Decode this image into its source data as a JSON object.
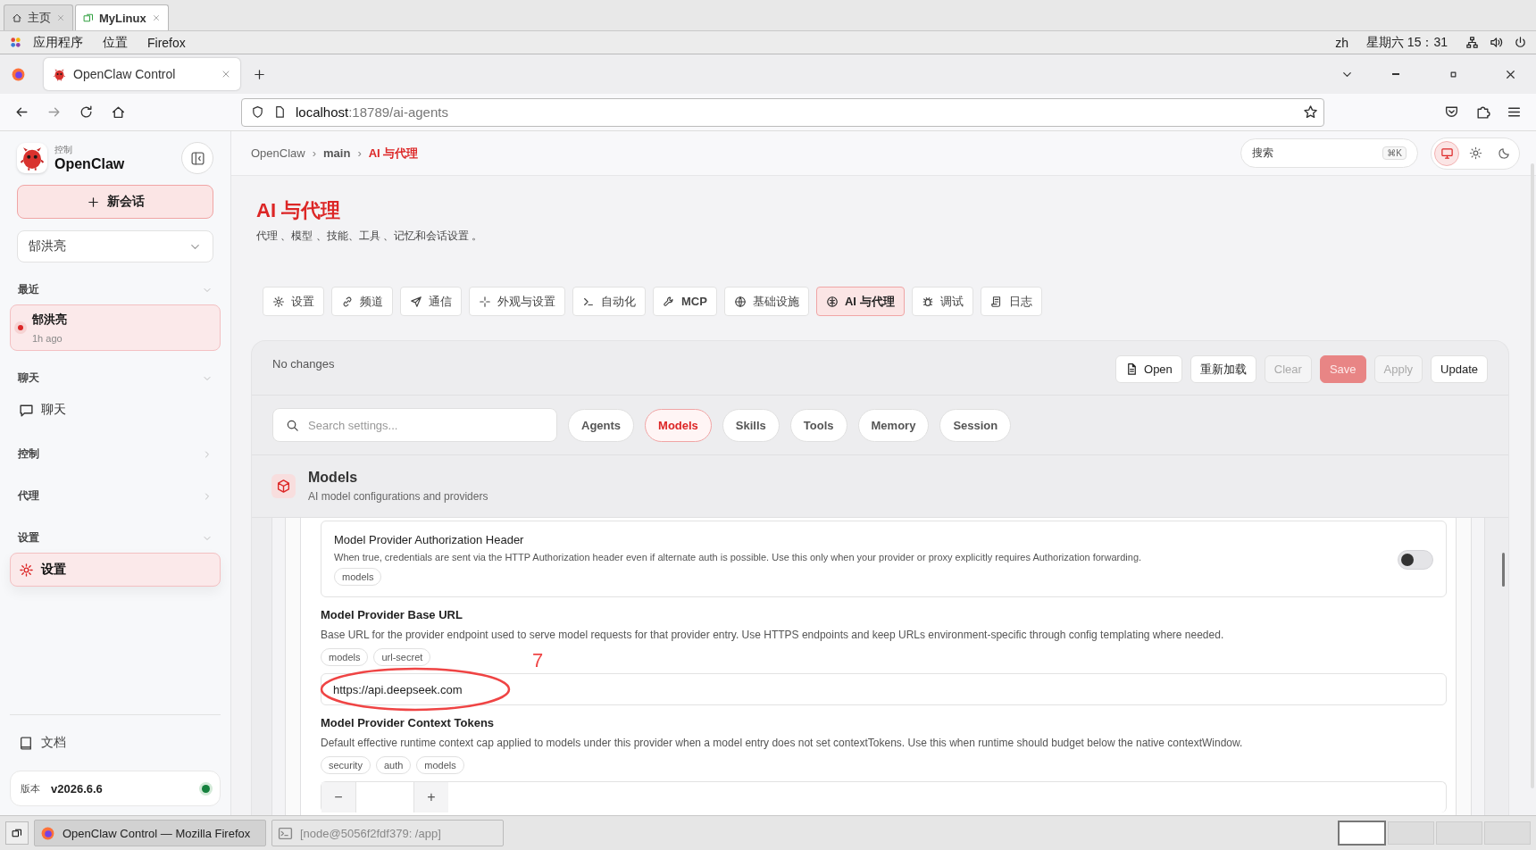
{
  "desktop_tabs": [
    {
      "label": "主页",
      "selected": false
    },
    {
      "label": "MyLinux",
      "selected": true
    }
  ],
  "desktop_menu": [
    "应用程序",
    "位置",
    "Firefox"
  ],
  "desktop_status": {
    "language": "zh",
    "clock": "星期六 15：31"
  },
  "browser_tab": {
    "title": "OpenClaw Control"
  },
  "url": {
    "host": "localhost",
    "rest": ":18789/ai-agents"
  },
  "brand": {
    "caption": "控制",
    "name": "OpenClaw"
  },
  "new_session": {
    "label": "新会话"
  },
  "agent_select": {
    "value": "郜洪亮"
  },
  "sidebar_sections": [
    {
      "title": "最近",
      "expanded": true,
      "items": [
        {
          "kind": "session",
          "label": "郜洪亮",
          "meta": "1h ago",
          "selected": true
        }
      ]
    },
    {
      "title": "聊天",
      "expanded": true,
      "items": [
        {
          "kind": "chat",
          "label": "聊天",
          "selected": false
        }
      ]
    },
    {
      "title": "控制",
      "expanded": false
    },
    {
      "title": "代理",
      "expanded": false
    },
    {
      "title": "设置",
      "expanded": true,
      "items": [
        {
          "kind": "settings",
          "label": "设置",
          "selected": true
        }
      ]
    }
  ],
  "docs_link": {
    "label": "文档"
  },
  "version": {
    "label": "版本",
    "value": "v2026.6.6",
    "online": true
  },
  "breadcrumb": [
    {
      "label": "OpenClaw",
      "kind": "root"
    },
    {
      "label": "main",
      "kind": "agent",
      "separator": "›"
    },
    {
      "label": "AI 与代理",
      "kind": "current",
      "separator": "›"
    }
  ],
  "search": {
    "placeholder": "搜索",
    "shortcut": "⌘K"
  },
  "theme_modes": [
    {
      "kind": "system",
      "selected": true
    },
    {
      "kind": "light",
      "selected": false
    },
    {
      "kind": "dark",
      "selected": false
    }
  ],
  "page": {
    "title": "AI 与代理",
    "subtitle": "代理 、模型 、技能、工具 、记忆和会话设置 。"
  },
  "nav_tabs": [
    {
      "label": "设置",
      "selected": false
    },
    {
      "label": "频道",
      "selected": false
    },
    {
      "label": "通信",
      "selected": false
    },
    {
      "label": "外观与设置",
      "selected": false
    },
    {
      "label": "自动化",
      "selected": false
    },
    {
      "label": "MCP",
      "selected": false
    },
    {
      "label": "基础设施",
      "selected": false
    },
    {
      "label": "AI 与代理",
      "selected": true
    },
    {
      "label": "调试",
      "selected": false
    },
    {
      "label": "日志",
      "selected": false
    }
  ],
  "status": "No changes",
  "actions": [
    {
      "label": "Open",
      "kind": "open",
      "disabled": false
    },
    {
      "label": "重新加载",
      "kind": "plain",
      "disabled": false
    },
    {
      "label": "Clear",
      "kind": "plain",
      "disabled": true
    },
    {
      "label": "Save",
      "kind": "primary",
      "disabled": true
    },
    {
      "label": "Apply",
      "kind": "plain",
      "disabled": true
    },
    {
      "label": "Update",
      "kind": "plain",
      "disabled": false
    }
  ],
  "settings_search": {
    "placeholder": "Search settings..."
  },
  "filters": [
    {
      "label": "Agents",
      "selected": false
    },
    {
      "label": "Models",
      "selected": true
    },
    {
      "label": "Skills",
      "selected": false
    },
    {
      "label": "Tools",
      "selected": false
    },
    {
      "label": "Memory",
      "selected": false
    },
    {
      "label": "Session",
      "selected": false
    }
  ],
  "section": {
    "title": "Models",
    "subtitle": "AI model configurations and providers"
  },
  "fields": [
    {
      "kind": "toggle",
      "title": "Model Provider Authorization Header",
      "description": "When true, credentials are sent via the HTTP Authorization header even if alternate auth is possible. Use this only when your provider or proxy explicitly requires Authorization forwarding.",
      "tags": [
        "models"
      ],
      "on": false
    },
    {
      "kind": "text",
      "title": "Model Provider Base URL",
      "description": "Base URL for the provider endpoint used to serve model requests for that provider entry. Use HTTPS endpoints and keep URLs environment-specific through config templating where needed.",
      "tags": [
        "models",
        "url-secret"
      ],
      "value": "https://api.deepseek.com",
      "annotation": "7"
    },
    {
      "kind": "number",
      "title": "Model Provider Context Tokens",
      "description": "Default effective runtime context cap applied to models under this provider when a model entry does not set contextTokens. Use this when runtime should budget below the native contextWindow.",
      "tags": [
        "security",
        "auth",
        "models"
      ],
      "minus": "−",
      "plus": "+"
    }
  ],
  "taskbar": [
    {
      "label": "OpenClaw Control — Mozilla Firefox",
      "kind": "firefox",
      "selected": true
    },
    {
      "label": "[node@5056f2fdf379: /app]",
      "kind": "terminal",
      "selected": false
    }
  ],
  "workspaces": [
    {
      "selected": true
    },
    {
      "selected": false
    },
    {
      "selected": false
    },
    {
      "selected": false
    }
  ]
}
